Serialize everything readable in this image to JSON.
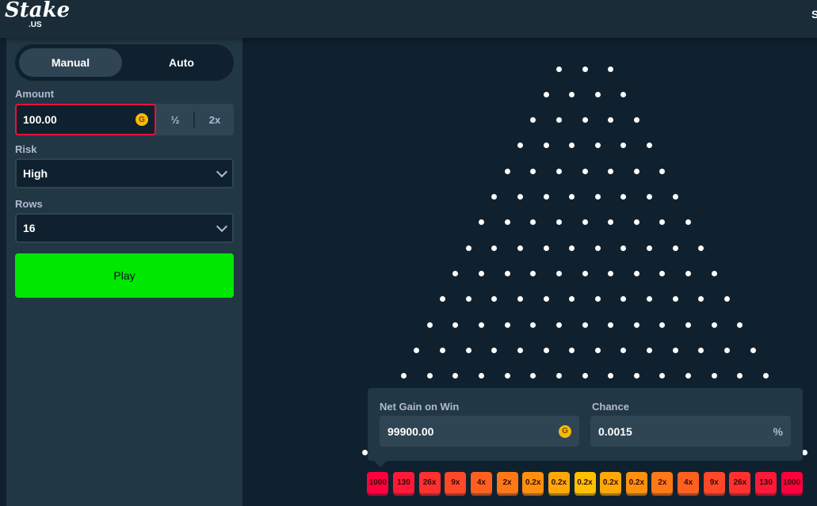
{
  "header": {
    "logo": "Stake",
    "logo_sub": ".US",
    "right_text": "S"
  },
  "sidebar": {
    "tabs": [
      {
        "label": "Manual"
      },
      {
        "label": "Auto"
      }
    ],
    "amount": {
      "label": "Amount",
      "value": "100.00",
      "currency_icon": "G",
      "half": "½",
      "double": "2x"
    },
    "risk": {
      "label": "Risk",
      "value": "High"
    },
    "rows": {
      "label": "Rows",
      "value": "16"
    },
    "play": "Play"
  },
  "board": {
    "rows": 16,
    "peg_color": "#ffffff"
  },
  "tooltip": {
    "net_gain_label": "Net Gain on Win",
    "net_gain_value": "99900.00",
    "currency_icon": "G",
    "chance_label": "Chance",
    "chance_value": "0.0015",
    "percent_icon": "%"
  },
  "buckets": [
    {
      "label": "1000",
      "color": "#ff003f"
    },
    {
      "label": "130",
      "color": "#ff1837"
    },
    {
      "label": "26x",
      "color": "#ff302f"
    },
    {
      "label": "9x",
      "color": "#ff4827"
    },
    {
      "label": "4x",
      "color": "#ff601f"
    },
    {
      "label": "2x",
      "color": "#ff7817"
    },
    {
      "label": "0.2x",
      "color": "#ff900f"
    },
    {
      "label": "0.2x",
      "color": "#ffa807"
    },
    {
      "label": "0.2x",
      "color": "#ffc000"
    },
    {
      "label": "0.2x",
      "color": "#ffa807"
    },
    {
      "label": "0.2x",
      "color": "#ff900f"
    },
    {
      "label": "2x",
      "color": "#ff7817"
    },
    {
      "label": "4x",
      "color": "#ff601f"
    },
    {
      "label": "9x",
      "color": "#ff4827"
    },
    {
      "label": "26x",
      "color": "#ff302f"
    },
    {
      "label": "130",
      "color": "#ff1837"
    },
    {
      "label": "1000",
      "color": "#ff003f"
    }
  ]
}
